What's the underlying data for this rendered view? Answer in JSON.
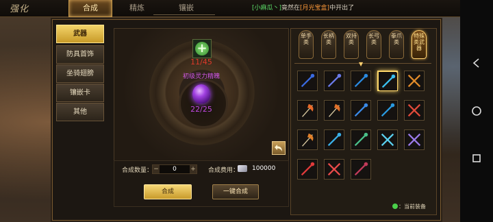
{
  "header": {
    "title": "强化",
    "tabs": [
      {
        "label": "合成",
        "active": true
      },
      {
        "label": "精炼",
        "active": false
      },
      {
        "label": "镶嵌",
        "active": false
      }
    ],
    "announcement": {
      "name": "[小麻瓜丶]",
      "middle": "竟然在",
      "item": "[月光宝盒]",
      "suffix": "中开出了"
    },
    "back_icon": "back-arrow-icon"
  },
  "categories": [
    {
      "label": "武器",
      "active": true
    },
    {
      "label": "防具首饰",
      "active": false
    },
    {
      "label": "坐骑翅膀",
      "active": false
    },
    {
      "label": "镶嵌卡",
      "active": false
    },
    {
      "label": "其他",
      "active": false
    }
  ],
  "craft": {
    "material_count": "11/45",
    "target_name": "初级灵力精魄",
    "target_count": "22/25",
    "quantity_label": "合成数量：",
    "quantity_value": "0",
    "minus": "−",
    "plus": "+",
    "cost_label": "合成费用：",
    "cost_value": "100000",
    "craft_button": "合成",
    "craft_all_button": "一键合成"
  },
  "weapon_tabs": [
    {
      "label": "单手类",
      "active": false
    },
    {
      "label": "长柄类",
      "active": false
    },
    {
      "label": "双持类",
      "active": false
    },
    {
      "label": "长弓类",
      "active": false
    },
    {
      "label": "拳爪类",
      "active": false
    },
    {
      "label": "特殊类武器",
      "active": true
    }
  ],
  "slots": [
    {
      "icon": "spear-blue-icon",
      "color": "#3a6ae0",
      "selected": false
    },
    {
      "icon": "staff-blue-icon",
      "color": "#6a7ae8",
      "selected": false
    },
    {
      "icon": "sword-blue-icon",
      "color": "#2a8ae0",
      "selected": false
    },
    {
      "icon": "blade-cyan-icon",
      "color": "#3ac0f0",
      "selected": true
    },
    {
      "icon": "cross-blades-orange-icon",
      "color": "#e08a2a",
      "selected": false
    },
    {
      "icon": "axe-fire-icon",
      "color": "#e86a2a",
      "selected": false
    },
    {
      "icon": "twin-axe-fire-icon",
      "color": "#e0702a",
      "selected": false
    },
    {
      "icon": "claw-blue-icon",
      "color": "#3a8ae8",
      "selected": false
    },
    {
      "icon": "crescent-blue-icon",
      "color": "#2a9ae0",
      "selected": false
    },
    {
      "icon": "trident-multicolor-icon",
      "color": "#e04a3a",
      "selected": false
    },
    {
      "icon": "twin-axe-orange-icon",
      "color": "#e0802a",
      "selected": false
    },
    {
      "icon": "lance-cyan-icon",
      "color": "#3ab0e8",
      "selected": false
    },
    {
      "icon": "halberd-green-icon",
      "color": "#4ac08a",
      "selected": false
    },
    {
      "icon": "cross-lances-cyan-icon",
      "color": "#5ad0f0",
      "selected": false
    },
    {
      "icon": "scepter-purple-icon",
      "color": "#9a7ae8",
      "selected": false
    },
    {
      "icon": "spear-red-icon",
      "color": "#e03a3a",
      "selected": false
    },
    {
      "icon": "cross-spears-red-icon",
      "color": "#e84a4a",
      "selected": false
    },
    {
      "icon": "scythe-red-icon",
      "color": "#c03a5a",
      "selected": false
    }
  ],
  "legend": {
    "label": "：当前装备"
  },
  "system_nav": [
    "back-nav-icon",
    "home-nav-icon",
    "recent-apps-icon"
  ]
}
